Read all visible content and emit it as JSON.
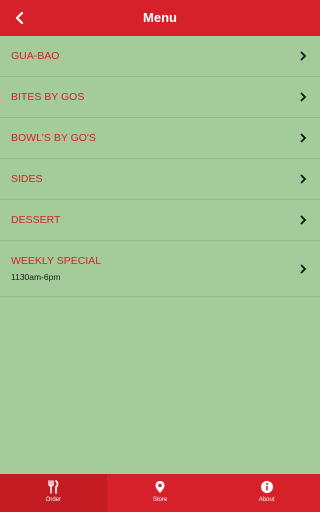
{
  "header": {
    "title": "Menu",
    "back_icon": "chevron-left-icon"
  },
  "menu": {
    "items": [
      {
        "label": "GUA-BAO"
      },
      {
        "label": "BITES BY GOS"
      },
      {
        "label": "BOWL'S BY GO'S"
      },
      {
        "label": "SIDES"
      },
      {
        "label": "DESSERT"
      },
      {
        "label": "WEEKLY SPECIAL",
        "subtitle": "1130am-6pm"
      }
    ]
  },
  "tabs": [
    {
      "label": "Order",
      "icon": "fork-knife-icon",
      "active": true
    },
    {
      "label": "Store",
      "icon": "map-pin-icon"
    },
    {
      "label": "About",
      "icon": "info-icon"
    }
  ],
  "colors": {
    "accent": "#d7212a",
    "background": "#a4cc9a"
  }
}
